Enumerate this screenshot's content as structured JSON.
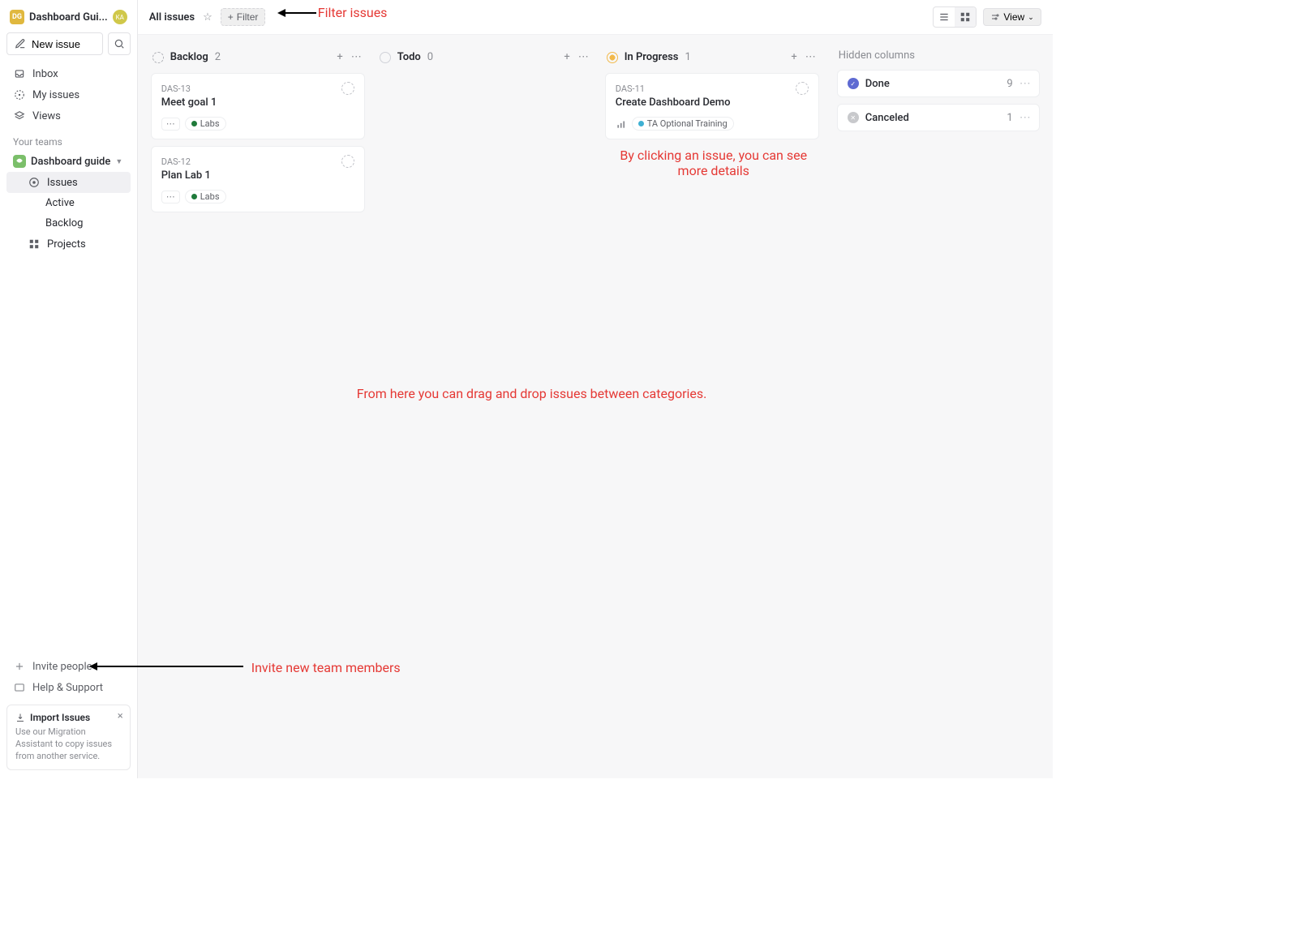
{
  "workspace": {
    "badge": "DG",
    "name": "Dashboard Gui...",
    "avatar": "KA"
  },
  "sidebar": {
    "new_issue": "New issue",
    "nav": {
      "inbox": "Inbox",
      "my_issues": "My issues",
      "views": "Views"
    },
    "teams_label": "Your teams",
    "team": {
      "name": "Dashboard guide"
    },
    "team_nav": {
      "issues": "Issues",
      "active": "Active",
      "backlog": "Backlog",
      "projects": "Projects"
    },
    "footer": {
      "invite": "Invite people",
      "help": "Help & Support"
    },
    "import": {
      "title": "Import Issues",
      "desc": "Use our Migration Assistant to copy issues from another service."
    }
  },
  "topbar": {
    "breadcrumb": "All issues",
    "filter": "Filter",
    "view": "View"
  },
  "columns": [
    {
      "key": "backlog",
      "title": "Backlog",
      "count": "2",
      "status": "dashed",
      "cards": [
        {
          "id": "DAS-13",
          "title": "Meet goal 1",
          "labels": [
            {
              "name": "Labs",
              "color": "#1f7a3a"
            }
          ],
          "more": true,
          "assignee_empty": true
        },
        {
          "id": "DAS-12",
          "title": "Plan Lab 1",
          "labels": [
            {
              "name": "Labs",
              "color": "#1f7a3a"
            }
          ],
          "more": true,
          "assignee_empty": true
        }
      ]
    },
    {
      "key": "todo",
      "title": "Todo",
      "count": "0",
      "status": "dashed",
      "cards": []
    },
    {
      "key": "inprogress",
      "title": "In Progress",
      "count": "1",
      "status": "inprog",
      "cards": [
        {
          "id": "DAS-11",
          "title": "Create Dashboard Demo",
          "priority": true,
          "labels": [
            {
              "name": "TA Optional Training",
              "color": "#3fb0d3"
            }
          ],
          "assignee_empty": true
        }
      ]
    }
  ],
  "hidden": {
    "label": "Hidden columns",
    "rows": [
      {
        "status": "done",
        "title": "Done",
        "count": "9",
        "more": true
      },
      {
        "status": "canceled",
        "title": "Canceled",
        "count": "1",
        "more": true
      }
    ]
  },
  "annotations": {
    "filter": "Filter issues",
    "click_issue": "By clicking an issue, you can see more details",
    "drag": "From here you can drag and drop issues between categories.",
    "invite": "Invite new team members"
  }
}
